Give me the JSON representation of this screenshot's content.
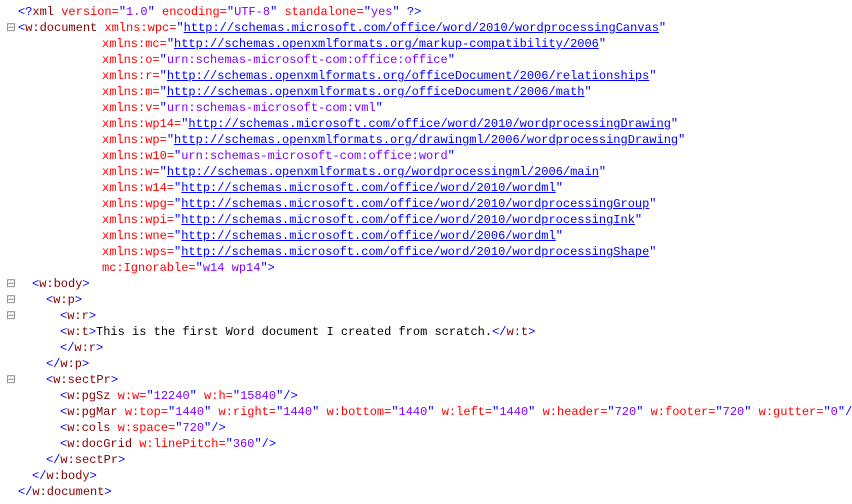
{
  "xml_decl": {
    "version": "1.0",
    "encoding": "UTF-8",
    "standalone": "yes"
  },
  "root": "w:document",
  "namespaces": [
    {
      "prefix": "xmlns:wpc",
      "value": "http://schemas.microsoft.com/office/word/2010/wordprocessingCanvas",
      "isUrl": true
    },
    {
      "prefix": "xmlns:mc",
      "value": "http://schemas.openxmlformats.org/markup-compatibility/2006",
      "isUrl": true
    },
    {
      "prefix": "xmlns:o",
      "value": "urn:schemas-microsoft-com:office:office",
      "isUrl": false
    },
    {
      "prefix": "xmlns:r",
      "value": "http://schemas.openxmlformats.org/officeDocument/2006/relationships",
      "isUrl": true
    },
    {
      "prefix": "xmlns:m",
      "value": "http://schemas.openxmlformats.org/officeDocument/2006/math",
      "isUrl": true
    },
    {
      "prefix": "xmlns:v",
      "value": "urn:schemas-microsoft-com:vml",
      "isUrl": false
    },
    {
      "prefix": "xmlns:wp14",
      "value": "http://schemas.microsoft.com/office/word/2010/wordprocessingDrawing",
      "isUrl": true
    },
    {
      "prefix": "xmlns:wp",
      "value": "http://schemas.openxmlformats.org/drawingml/2006/wordprocessingDrawing",
      "isUrl": true
    },
    {
      "prefix": "xmlns:w10",
      "value": "urn:schemas-microsoft-com:office:word",
      "isUrl": false
    },
    {
      "prefix": "xmlns:w",
      "value": "http://schemas.openxmlformats.org/wordprocessingml/2006/main",
      "isUrl": true
    },
    {
      "prefix": "xmlns:w14",
      "value": "http://schemas.microsoft.com/office/word/2010/wordml",
      "isUrl": true
    },
    {
      "prefix": "xmlns:wpg",
      "value": "http://schemas.microsoft.com/office/word/2010/wordprocessingGroup",
      "isUrl": true
    },
    {
      "prefix": "xmlns:wpi",
      "value": "http://schemas.microsoft.com/office/word/2010/wordprocessingInk",
      "isUrl": true
    },
    {
      "prefix": "xmlns:wne",
      "value": "http://schemas.microsoft.com/office/word/2006/wordml",
      "isUrl": true
    },
    {
      "prefix": "xmlns:wps",
      "value": "http://schemas.microsoft.com/office/word/2010/wordprocessingShape",
      "isUrl": true
    }
  ],
  "mc_ignorable": {
    "name": "mc:Ignorable",
    "value": "w14 wp14"
  },
  "body_tag": "w:body",
  "p_tag": "w:p",
  "r_tag": "w:r",
  "t_tag": "w:t",
  "text_content": "This is the first Word document I created from scratch.",
  "sectPr_tag": "w:sectPr",
  "pgSz": {
    "tag": "w:pgSz",
    "attrs": [
      {
        "n": "w:w",
        "v": "12240"
      },
      {
        "n": "w:h",
        "v": "15840"
      }
    ]
  },
  "pgMar": {
    "tag": "w:pgMar",
    "attrs": [
      {
        "n": "w:top",
        "v": "1440"
      },
      {
        "n": "w:right",
        "v": "1440"
      },
      {
        "n": "w:bottom",
        "v": "1440"
      },
      {
        "n": "w:left",
        "v": "1440"
      },
      {
        "n": "w:header",
        "v": "720"
      },
      {
        "n": "w:footer",
        "v": "720"
      },
      {
        "n": "w:gutter",
        "v": "0"
      }
    ]
  },
  "cols": {
    "tag": "w:cols",
    "attrs": [
      {
        "n": "w:space",
        "v": "720"
      }
    ]
  },
  "docGrid": {
    "tag": "w:docGrid",
    "attrs": [
      {
        "n": "w:linePitch",
        "v": "360"
      }
    ]
  },
  "fold": {
    "plus": "⊞",
    "minus": "⊟"
  }
}
